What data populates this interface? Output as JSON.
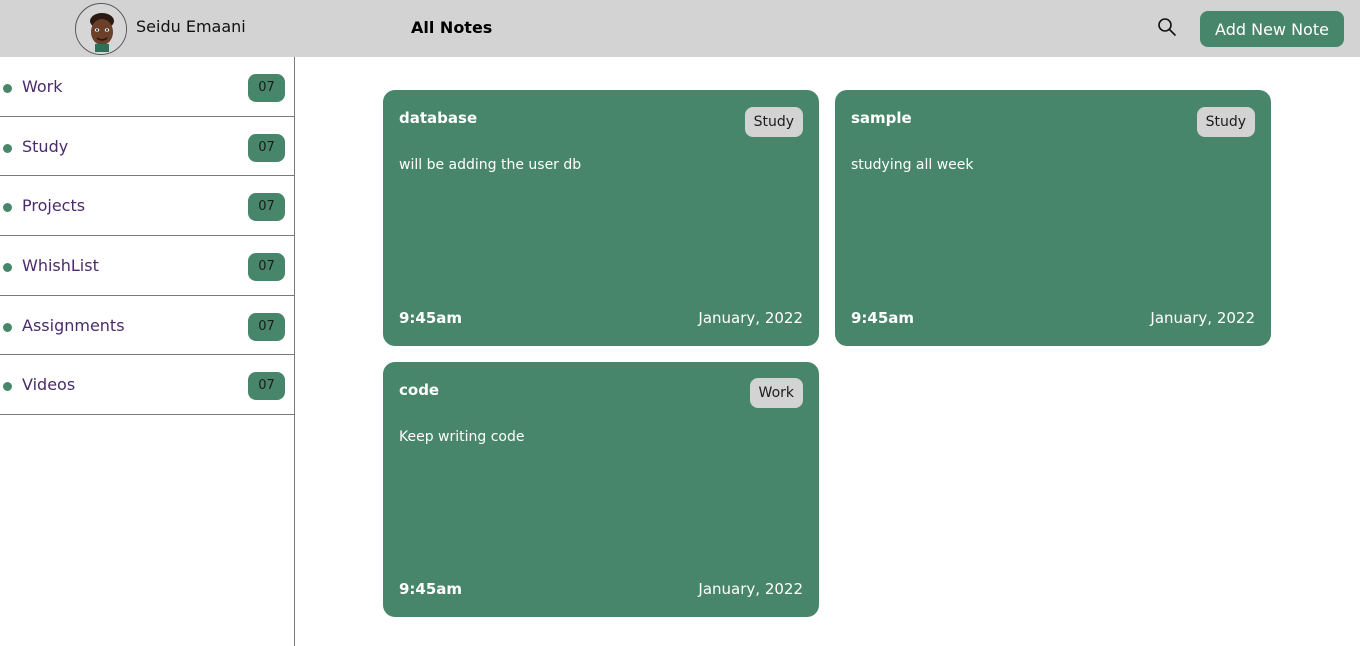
{
  "header": {
    "user_name": "Seidu Emaani",
    "page_title": "All Notes",
    "search_icon": "search-icon",
    "add_button_label": "Add New Note"
  },
  "sidebar": {
    "items": [
      {
        "label": "Work",
        "count": "07"
      },
      {
        "label": "Study",
        "count": "07"
      },
      {
        "label": "Projects",
        "count": "07"
      },
      {
        "label": "WhishList",
        "count": "07"
      },
      {
        "label": "Assignments",
        "count": "07"
      },
      {
        "label": "Videos",
        "count": "07"
      }
    ]
  },
  "notes": [
    {
      "title": "database",
      "tag": "Study",
      "body": "will be adding the user db",
      "time": "9:45am",
      "date": "January, 2022"
    },
    {
      "title": "sample",
      "tag": "Study",
      "body": "studying all week",
      "time": "9:45am",
      "date": "January, 2022"
    },
    {
      "title": "code",
      "tag": "Work",
      "body": "Keep writing code",
      "time": "9:45am",
      "date": "January, 2022"
    }
  ],
  "colors": {
    "accent": "#48866b",
    "header_bg": "#d3d3d3",
    "category_text": "#4a2a6b"
  }
}
